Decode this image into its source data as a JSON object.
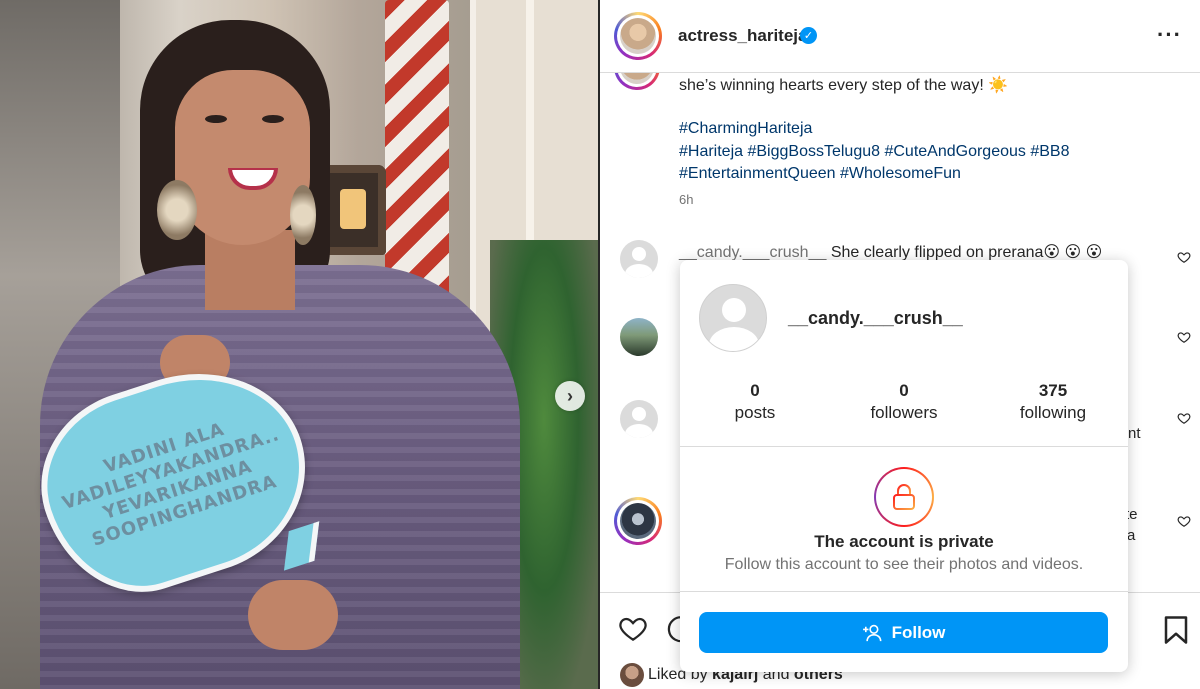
{
  "photo": {
    "sign_lines": [
      "VADINI ALA",
      "VADILEYYAKANDRA..",
      "YEVARIKANNA",
      "SOOPINGHANDRA"
    ],
    "next_icon": "chevron-right-icon"
  },
  "post": {
    "username": "actress_hariteja",
    "verified_icon": "verified-badge-icon",
    "more_icon": "more-horizontal-icon",
    "caption_text": "she’s winning hearts every step of the way! ☀️",
    "hashtag_lines": [
      "#CharmingHariteja",
      "#Hariteja #BiggBossTelugu8 #CuteAndGorgeous #BB8",
      "#EntertainmentQueen #WholesomeFun"
    ],
    "time": "6h"
  },
  "comments": [
    {
      "username": "__candy.___crush__",
      "text": "She clearly flipped on prerana😮 😮 😮"
    },
    {
      "partial_text": "nt"
    },
    {
      "partial_text": "te"
    },
    {
      "partial_text": "a"
    }
  ],
  "popup": {
    "username": "__candy.___crush__",
    "stats": [
      {
        "value": "0",
        "label": "posts"
      },
      {
        "value": "0",
        "label": "followers"
      },
      {
        "value": "375",
        "label": "following"
      }
    ],
    "private_title": "The account is private",
    "private_subtitle": "Follow this account to see their photos and videos.",
    "follow_label": "Follow",
    "follow_icon": "add-person-icon",
    "lock_icon": "lock-icon"
  },
  "actions": {
    "like_icon": "heart-icon",
    "comment_icon": "comment-icon",
    "save_icon": "bookmark-icon",
    "liked_prefix": "Liked by",
    "liked_user": "kajalrj",
    "liked_and": "and",
    "liked_others": "others"
  },
  "colors": {
    "accent": "#0095f6",
    "hashtag": "#00376b",
    "muted": "#737373"
  }
}
